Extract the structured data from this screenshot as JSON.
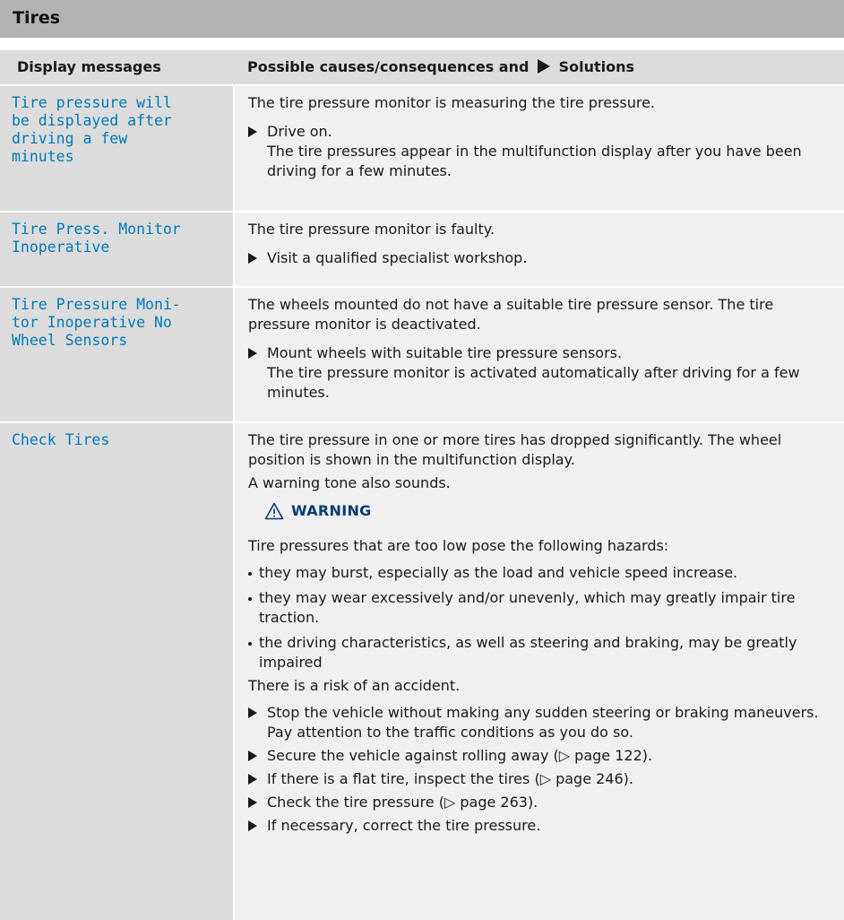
{
  "section_title": "Tires",
  "table": {
    "header_col1": "Display messages",
    "header_col2_a": "Possible causes/consequences and",
    "header_col2_b": "Solutions"
  },
  "rows": [
    {
      "message": "Tire pressure will\nbe displayed after\ndriving a few\nminutes",
      "cause": "The tire pressure monitor is measuring the tire pressure.",
      "steps": [
        "Drive on.\nThe tire pressures appear in the multifunction display after you have been driving for a few minutes."
      ]
    },
    {
      "message": "Tire Press. Monitor\nInoperative",
      "cause": "The tire pressure monitor is faulty.",
      "steps": [
        "Visit a qualified specialist workshop."
      ]
    },
    {
      "message": "Tire Pressure Moni-\ntor Inoperative No\nWheel Sensors",
      "cause": "The wheels mounted do not have a suitable tire pressure sensor. The tire pressure monitor is deactivated.",
      "steps": [
        "Mount wheels with suitable tire pressure sensors.\nThe tire pressure monitor is activated automatically after driving for a few minutes."
      ]
    },
    {
      "message": "Check Tires",
      "cause": "The tire pressure in one or more tires has dropped significantly. The wheel position is shown in the multifunction display.",
      "cause2": "A warning tone also sounds.",
      "warning_label": "WARNING",
      "warning_intro": "Tire pressures that are too low pose the following hazards:",
      "bullets": [
        "they may burst, especially as the load and vehicle speed increase.",
        "they may wear excessively and/or unevenly, which may greatly impair tire traction.",
        "the driving characteristics, as well as steering and braking, may be greatly impaired"
      ],
      "risk": "There is a risk of an accident.",
      "steps": [
        "Stop the vehicle without making any sudden steering or braking maneuvers. Pay attention to the traffic conditions as you do so.",
        "Secure the vehicle against rolling away (▷ page 122).",
        "If there is a flat tire, inspect the tires (▷ page 246).",
        "Check the tire pressure (▷ page 263).",
        "If necessary, correct the tire pressure."
      ]
    }
  ]
}
